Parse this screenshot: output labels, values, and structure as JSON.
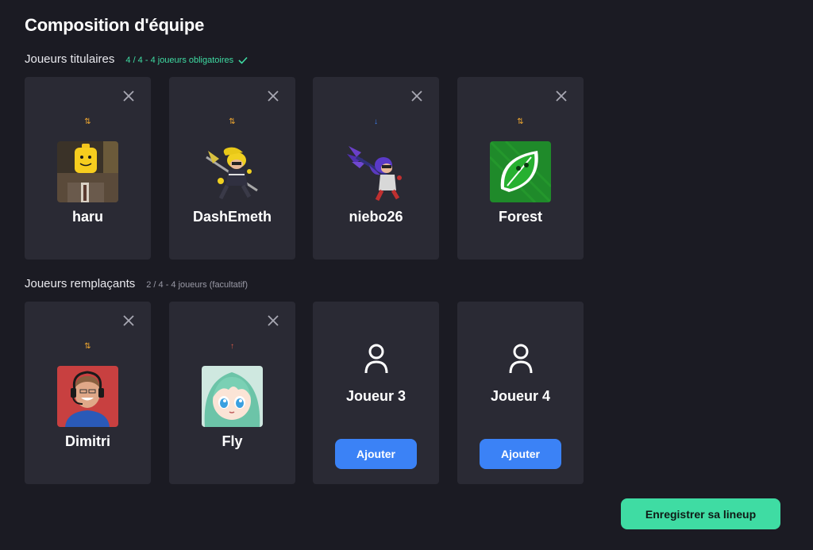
{
  "page": {
    "title": "Composition d'équipe"
  },
  "starters": {
    "label": "Joueurs titulaires",
    "note": "4 / 4 - 4 joueurs obligatoires",
    "players": [
      {
        "name": "haru",
        "role_icon": "swap-arrows-icon",
        "role_glyph": "⇅",
        "role_color": "#f0a830",
        "avatar": "lego-avatar"
      },
      {
        "name": "DashEmeth",
        "role_icon": "swap-arrows-icon",
        "role_glyph": "⇅",
        "role_color": "#f0a830",
        "avatar": "inkling-yellow-avatar"
      },
      {
        "name": "niebo26",
        "role_icon": "arrow-down-icon",
        "role_glyph": "↓",
        "role_color": "#3b82f6",
        "avatar": "inkling-purple-avatar"
      },
      {
        "name": "Forest",
        "role_icon": "swap-arrows-icon",
        "role_glyph": "⇅",
        "role_color": "#f0a830",
        "avatar": "leaf-avatar"
      }
    ]
  },
  "subs": {
    "label": "Joueurs remplaçants",
    "note": "2 / 4 - 4 joueurs (facultatif)",
    "players": [
      {
        "name": "Dimitri",
        "role_icon": "swap-arrows-icon",
        "role_glyph": "⇅",
        "role_color": "#f0a830",
        "avatar": "person-headset-avatar"
      },
      {
        "name": "Fly",
        "role_icon": "arrow-up-icon",
        "role_glyph": "↑",
        "role_color": "#e05a47",
        "avatar": "anime-girl-avatar"
      }
    ],
    "empty_slots": [
      {
        "name": "Joueur 3",
        "button": "Ajouter"
      },
      {
        "name": "Joueur 4",
        "button": "Ajouter"
      }
    ]
  },
  "save_button": "Enregistrer sa lineup",
  "colors": {
    "accent": "#3fdca3",
    "button_blue": "#3b82f6",
    "card_bg": "#2a2a34",
    "page_bg": "#1b1b23"
  }
}
